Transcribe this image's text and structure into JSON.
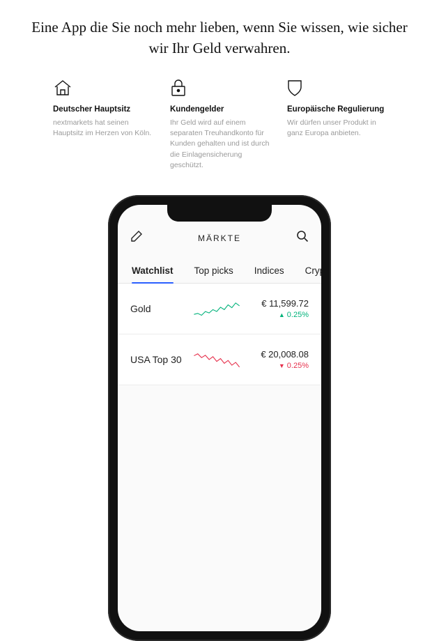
{
  "headline": "Eine App die Sie noch mehr lieben, wenn Sie wissen, wie sicher wir Ihr Geld verwahren.",
  "features": [
    {
      "icon": "house-icon",
      "title": "Deutscher Hauptsitz",
      "desc": "nextmarkets hat seinen Hauptsitz im Herzen von Köln."
    },
    {
      "icon": "lock-icon",
      "title": "Kundengelder",
      "desc": "Ihr Geld wird auf einem separaten Treuhandkonto für Kunden gehalten und ist durch die Einlagensicherung geschützt."
    },
    {
      "icon": "shield-icon",
      "title": "Europäische Regulierung",
      "desc": "Wir dürfen unser Produkt in ganz Europa anbieten."
    }
  ],
  "app": {
    "title": "MÄRKTE",
    "tabs": [
      "Watchlist",
      "Top picks",
      "Indices",
      "Crypto"
    ],
    "active_tab": 0,
    "rows": [
      {
        "name": "Gold",
        "price": "€ 11,599.72",
        "delta": "0.25%",
        "direction": "up",
        "spark_color": "#00b27a"
      },
      {
        "name": "USA Top 30",
        "price": "€ 20,008.08",
        "delta": "0.25%",
        "direction": "down",
        "spark_color": "#e6304c"
      }
    ]
  }
}
